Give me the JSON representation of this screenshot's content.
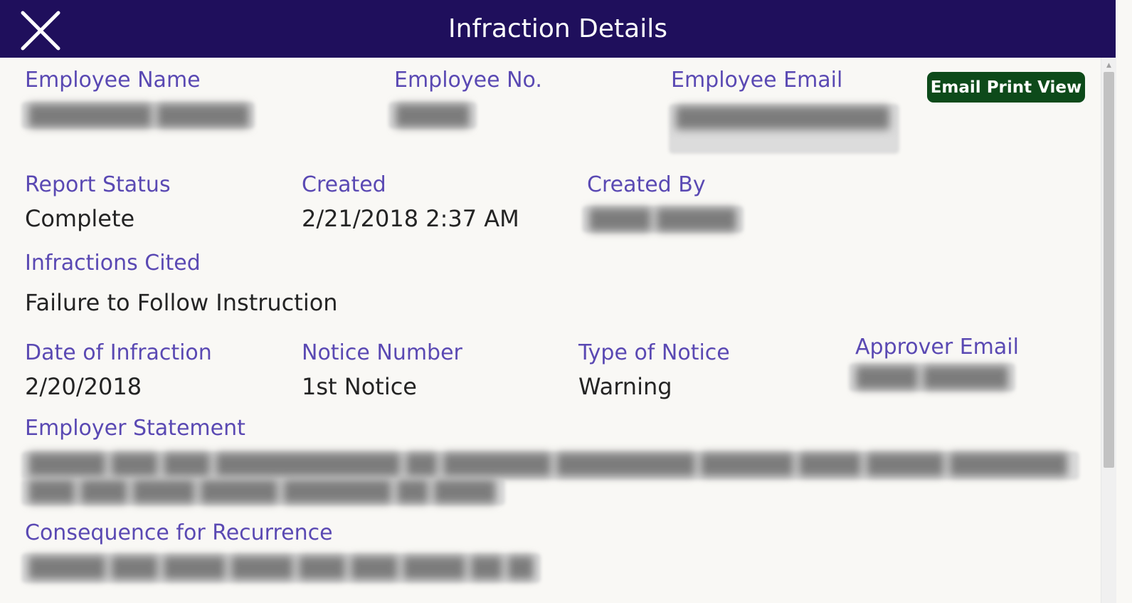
{
  "header": {
    "title": "Infraction Details",
    "close_icon": "close-icon"
  },
  "actions": {
    "email_print_label": "Email Print View"
  },
  "fields": {
    "employee_name_label": "Employee Name",
    "employee_no_label": "Employee No.",
    "employee_email_label": "Employee Email",
    "report_status_label": "Report Status",
    "report_status_value": "Complete",
    "created_label": "Created",
    "created_value": "2/21/2018 2:37 AM",
    "created_by_label": "Created By",
    "infractions_cited_label": "Infractions Cited",
    "infractions_cited_value": "Failure to Follow Instruction",
    "date_of_infraction_label": "Date of Infraction",
    "date_of_infraction_value": "2/20/2018",
    "notice_number_label": "Notice Number",
    "notice_number_value": "1st Notice",
    "type_of_notice_label": "Type of Notice",
    "type_of_notice_value": "Warning",
    "approver_email_label": "Approver Email",
    "employer_statement_label": "Employer Statement",
    "consequence_label": "Consequence for Recurrence"
  },
  "colors": {
    "header_bg": "#1f0f5c",
    "label": "#5a49b3",
    "value": "#242424",
    "button_bg": "#0d4a1a",
    "page_bg": "#f9f8f5"
  }
}
